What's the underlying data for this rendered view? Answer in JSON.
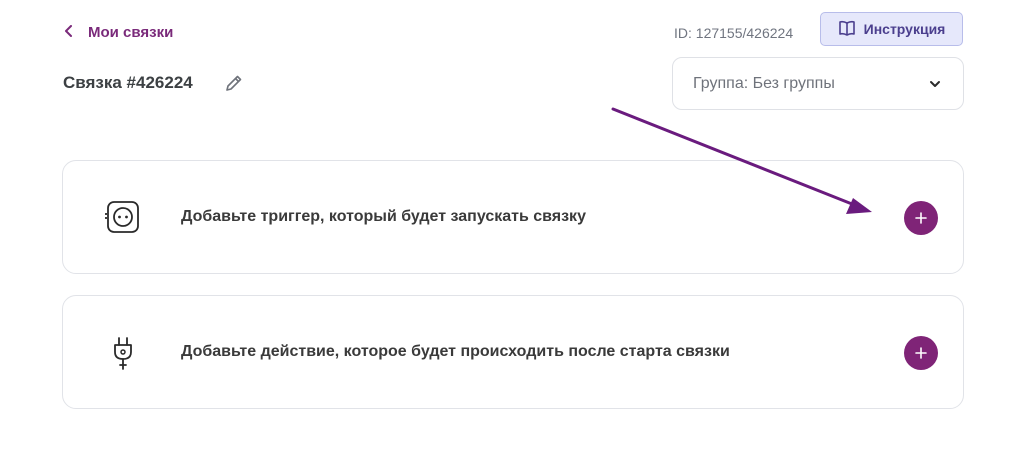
{
  "header": {
    "back_link_label": "Мои связки",
    "title": "Связка #426224",
    "id_label": "ID: 127155/426224",
    "instruction_label": "Инструкция"
  },
  "group_select": {
    "value": "Группа: Без группы"
  },
  "cards": [
    {
      "text": "Добавьте триггер, который будет запускать связку",
      "icon": "socket-icon"
    },
    {
      "text": "Добавьте действие, которое будет происходить после старта связки",
      "icon": "plug-icon"
    }
  ],
  "colors": {
    "accent": "#7f2477",
    "link": "#7a2a7a",
    "instruction_bg": "#e6e8fb",
    "annotation_arrow": "#6a1b7e"
  }
}
